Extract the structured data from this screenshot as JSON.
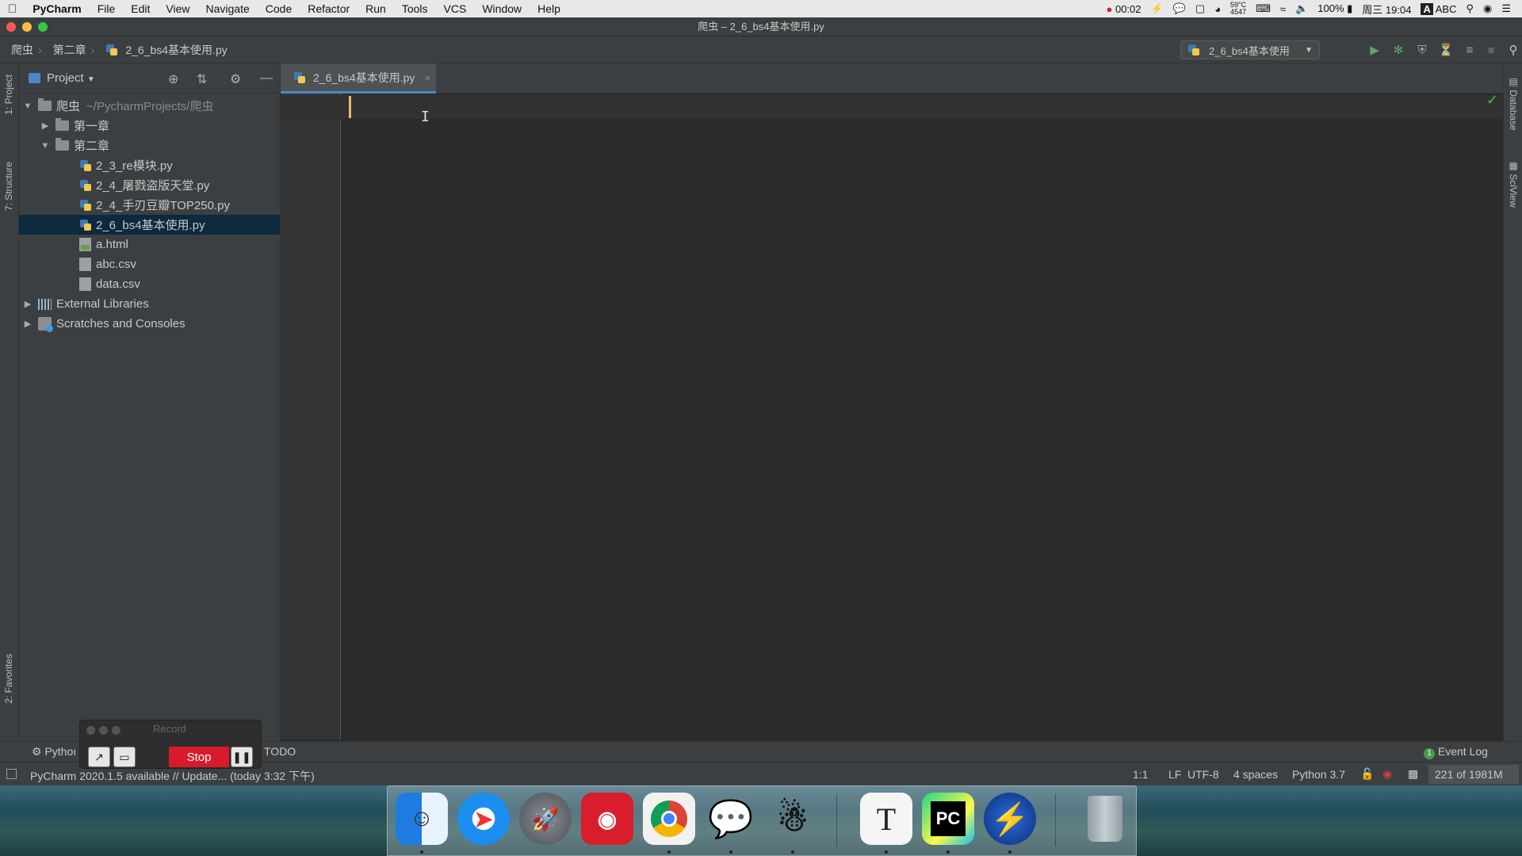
{
  "menubar": {
    "app": "PyCharm",
    "items": [
      "File",
      "Edit",
      "View",
      "Navigate",
      "Code",
      "Refactor",
      "Run",
      "Tools",
      "VCS",
      "Window",
      "Help"
    ],
    "status": {
      "timer": "00:02",
      "temp": "59°C",
      "temp_sub": "4547",
      "battery": "100%",
      "clock": "周三 19:04",
      "input_method": "ABC"
    }
  },
  "window": {
    "title": "爬虫 – 2_6_bs4基本使用.py"
  },
  "navbar": {
    "crumbs": [
      "爬虫",
      "第二章",
      "2_6_bs4基本使用.py"
    ],
    "run_config": "2_6_bs4基本使用"
  },
  "left_stripe": {
    "project_tab": "1: Project",
    "structure_tab": "7: Structure",
    "favorites_tab": "2: Favorites"
  },
  "project": {
    "header": "Project",
    "root_name": "爬虫",
    "root_path": "~/PycharmProjects/爬虫",
    "folder1": "第一章",
    "folder2": "第二章",
    "files": [
      "2_3_re模块.py",
      "2_4_屠戮盗版天堂.py",
      "2_4_手刃豆瓣TOP250.py",
      "2_6_bs4基本使用.py",
      "a.html",
      "abc.csv",
      "data.csv"
    ],
    "external_libraries": "External Libraries",
    "scratches": "Scratches and Consoles"
  },
  "editor": {
    "tab_label": "2_6_bs4基本使用.py"
  },
  "right_stripe": {
    "database_tab": "Database",
    "sciview_tab": "SciView"
  },
  "bottom": {
    "python_tab": "Pythoı",
    "todo_tab": "TODO",
    "event_log": "Event Log",
    "event_count": "1",
    "status_message": "PyCharm 2020.1.5 available // Update... (today 3:32 下午)",
    "position": "1:1",
    "line_sep": "LF",
    "encoding": "UTF-8",
    "indent": "4 spaces",
    "interpreter": "Python 3.7",
    "memory": "221 of 1981M"
  },
  "record": {
    "title": "Record",
    "stop_label": "Stop"
  },
  "dock": {
    "apps": [
      "finder-icon",
      "safari-icon",
      "launchpad-icon",
      "netease-music-icon",
      "chrome-icon",
      "wechat-icon",
      "qq-icon",
      "typora-icon",
      "pycharm-icon",
      "thunder-icon",
      "trash-icon"
    ]
  }
}
